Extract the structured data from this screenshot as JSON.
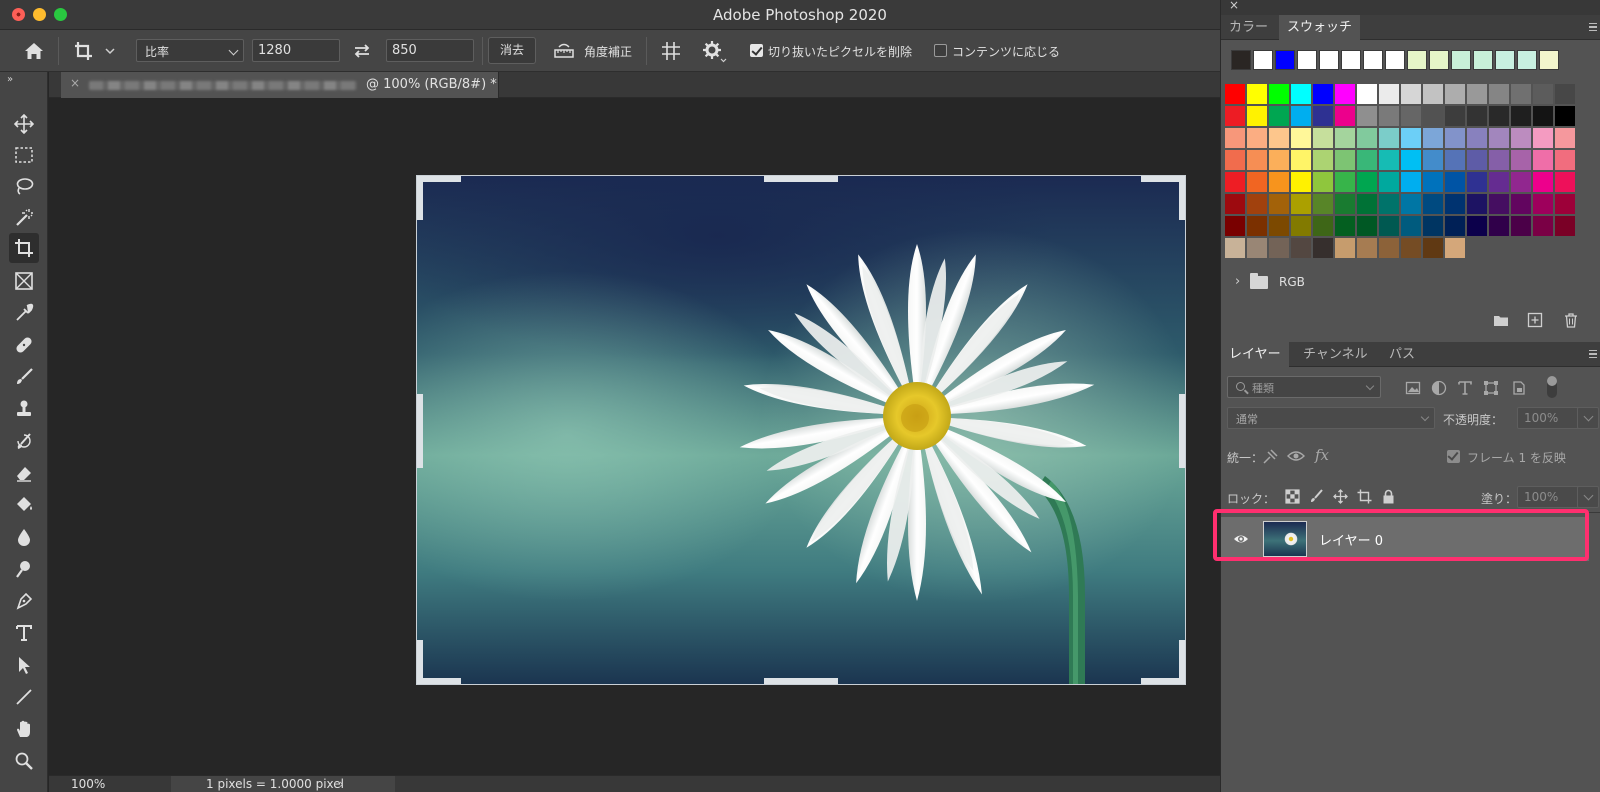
{
  "window": {
    "title": "Adobe Photoshop 2020"
  },
  "options_bar": {
    "ratio_select": "比率",
    "width_value": "1280",
    "height_value": "850",
    "clear_label": "消去",
    "straighten_label": "角度補正",
    "delete_cropped_label": "切り抜いたピクセルを削除",
    "delete_cropped_checked": true,
    "content_aware_label": "コンテンツに応じる",
    "content_aware_checked": false
  },
  "document": {
    "tab_label": "@ 100% (RGB/8#) *",
    "zoom": "100%",
    "pixel_info": "1 pixels = 1.0000 pixel"
  },
  "tools": [
    "move-tool",
    "marquee-tool",
    "lasso-tool",
    "magic-wand-tool",
    "crop-tool",
    "frame-tool",
    "eyedropper-tool",
    "healing-brush-tool",
    "brush-tool",
    "clone-stamp-tool",
    "history-brush-tool",
    "eraser-tool",
    "paint-bucket-tool",
    "blur-tool",
    "dodge-tool",
    "pen-tool",
    "type-tool",
    "path-selection-tool",
    "line-tool",
    "hand-tool",
    "zoom-tool"
  ],
  "swatches_panel": {
    "tabs": [
      "カラー",
      "スウォッチ"
    ],
    "active_tab": "スウォッチ",
    "recent": [
      "#2a2623",
      "#ffffff",
      "#0000ff",
      "#ffffff",
      "#ffffff",
      "#ffffff",
      "#ffffff",
      "#ffffff",
      "#e5f5c8",
      "#e5f5c8",
      "#c8f0d8",
      "#c8f0d8",
      "#c8f0e0",
      "#c8f0e0",
      "#f2f5cc"
    ],
    "rows": [
      [
        "#ff0000",
        "#ffff00",
        "#00ff00",
        "#00ffff",
        "#0000ff",
        "#ff00ff",
        "#ffffff",
        "#ebebeb",
        "#d6d6d6",
        "#c2c2c2",
        "#adadad",
        "#999999",
        "#858585",
        "#707070",
        "#5c5c5c",
        "#474747"
      ],
      [
        "#ed1c24",
        "#fff200",
        "#00a651",
        "#00aeef",
        "#2e3192",
        "#ec008c",
        "#8f8f8f",
        "#7a7a7a",
        "#666666",
        "#525252",
        "#3d3d3d",
        "#333333",
        "#292929",
        "#1f1f1f",
        "#141414",
        "#000000"
      ],
      [
        "#f7977a",
        "#fbad82",
        "#fdc68c",
        "#fff799",
        "#c6df9c",
        "#a4d49d",
        "#81ca9d",
        "#7bcdc9",
        "#6ccff7",
        "#7ca6d8",
        "#8293ca",
        "#8881be",
        "#a286bd",
        "#bc8cbf",
        "#f49bc1",
        "#f5989d"
      ],
      [
        "#f16c4d",
        "#f68e54",
        "#fbaf5a",
        "#fff467",
        "#acd372",
        "#7dc473",
        "#39b778",
        "#16bcb4",
        "#00bff3",
        "#438ccb",
        "#5573b7",
        "#5e5ca7",
        "#855fa8",
        "#a763a9",
        "#ef6ea8",
        "#f16d7e"
      ],
      [
        "#ee1d24",
        "#f16522",
        "#f7941d",
        "#fff100",
        "#8fc63d",
        "#37b44a",
        "#00a650",
        "#00a99e",
        "#00aeef",
        "#0072bc",
        "#0054a5",
        "#2f3192",
        "#652c91",
        "#91278f",
        "#ed008c",
        "#ee105a"
      ],
      [
        "#9d0a0f",
        "#a1410d",
        "#a36209",
        "#aba000",
        "#588528",
        "#197b30",
        "#007236",
        "#00736a",
        "#0076a4",
        "#004a80",
        "#003370",
        "#1d1363",
        "#450e61",
        "#62055f",
        "#9e005c",
        "#9d0039"
      ],
      [
        "#790000",
        "#7b3000",
        "#7c4900",
        "#827a00",
        "#3e6617",
        "#045f20",
        "#005824",
        "#005951",
        "#005b7e",
        "#003562",
        "#002056",
        "#0c004b",
        "#30004a",
        "#4b0048",
        "#7a0045",
        "#7a0026"
      ],
      [
        "#c8b298",
        "#998675",
        "#736357",
        "#534741",
        "#362f2d",
        "#c69c6d",
        "#a67c52",
        "#8c6239",
        "#754c24",
        "#603913",
        "#d4a77a"
      ]
    ],
    "folder_label": "RGB"
  },
  "layers_panel": {
    "tabs": [
      "レイヤー",
      "チャンネル",
      "パス"
    ],
    "active_tab": "レイヤー",
    "filter_placeholder": "種類",
    "blend_mode": "通常",
    "opacity_label": "不透明度：",
    "opacity_value": "100%",
    "unify_label": "統一：",
    "propagate_frame_label": "フレーム 1 を反映",
    "lock_label": "ロック：",
    "fill_label": "塗り：",
    "fill_value": "100%",
    "layers": [
      {
        "name": "レイヤー 0",
        "visible": true,
        "selected": true
      }
    ]
  },
  "colors": {
    "highlight": "#ff2f6f"
  }
}
